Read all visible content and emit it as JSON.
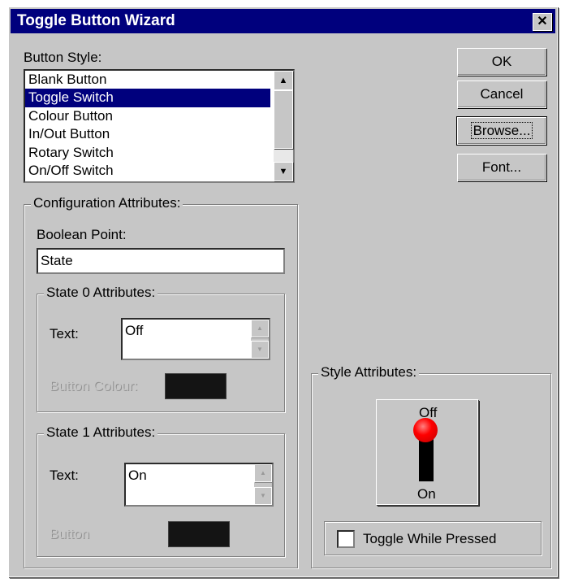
{
  "window": {
    "title": "Toggle Button Wizard",
    "close_symbol": "✕"
  },
  "button_style": {
    "label": "Button Style:",
    "items": [
      {
        "label": "Blank Button",
        "selected": false
      },
      {
        "label": "Toggle Switch",
        "selected": true
      },
      {
        "label": "Colour Button",
        "selected": false
      },
      {
        "label": "In/Out Button",
        "selected": false
      },
      {
        "label": "Rotary Switch",
        "selected": false
      },
      {
        "label": "On/Off Switch",
        "selected": false
      }
    ]
  },
  "buttons": {
    "ok": "OK",
    "cancel": "Cancel",
    "browse": "Browse...",
    "font": "Font..."
  },
  "config": {
    "title": "Configuration Attributes:",
    "boolean_point_label": "Boolean Point:",
    "boolean_point_value": "State",
    "state0": {
      "title": "State 0 Attributes:",
      "text_label": "Text:",
      "text_value": "Off",
      "colour_label": "Button Colour:",
      "colour": "#141414"
    },
    "state1": {
      "title": "State 1 Attributes:",
      "text_label": "Text:",
      "text_value": "On",
      "colour_label": "Button",
      "colour": "#141414"
    }
  },
  "style": {
    "title": "Style Attributes:",
    "preview_top": "Off",
    "preview_bottom": "On",
    "knob_color": "#ff0000",
    "toggle_label": "Toggle While Pressed",
    "toggle_checked": false
  }
}
